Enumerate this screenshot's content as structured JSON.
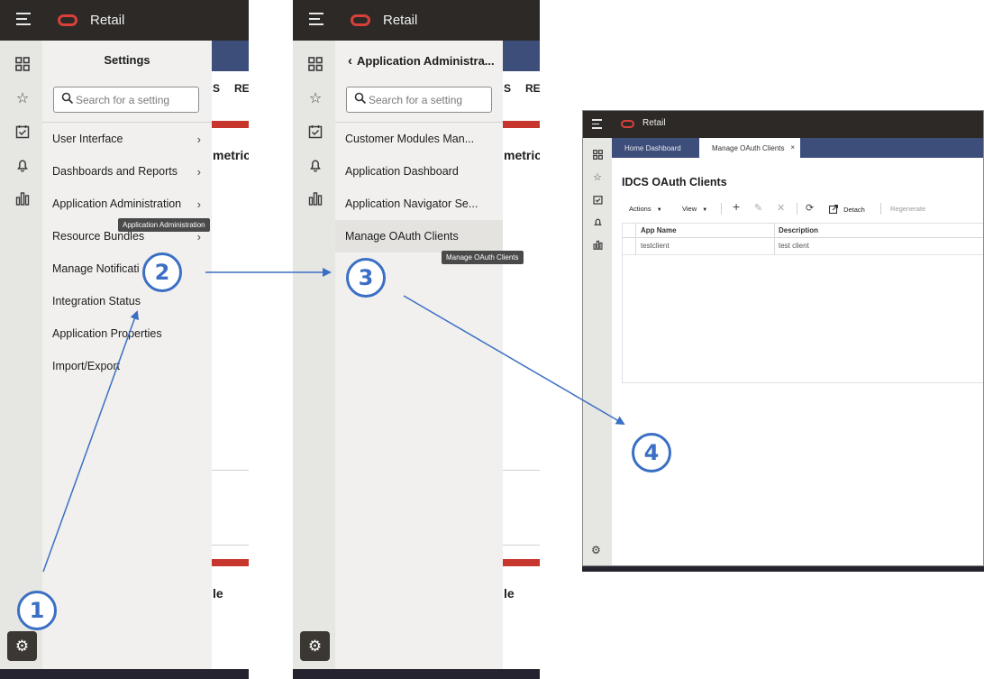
{
  "app": {
    "brand": "Retail"
  },
  "panel1": {
    "drawer_title": "Settings",
    "search_placeholder": "Search for a setting",
    "items": [
      {
        "label": "User Interface",
        "chevron": "›"
      },
      {
        "label": "Dashboards and Reports",
        "chevron": "›"
      },
      {
        "label": "Application Administration",
        "chevron": "›"
      },
      {
        "label": "Resource Bundles",
        "chevron": "›"
      },
      {
        "label": "Manage Notificati"
      },
      {
        "label": "Integration Status"
      },
      {
        "label": "Application Properties"
      },
      {
        "label": "Import/Export"
      }
    ],
    "tooltip": "Application Administration",
    "bg_text": {
      "tab": "S",
      "tab2": "RE",
      "heading": "metric",
      "heading2": "le"
    }
  },
  "panel2": {
    "back_title": "Application Administra...",
    "back_icon": "‹",
    "search_placeholder": "Search for a setting",
    "items": [
      {
        "label": "Customer Modules Man..."
      },
      {
        "label": "Application Dashboard"
      },
      {
        "label": "Application Navigator Se..."
      },
      {
        "label": "Manage OAuth Clients"
      }
    ],
    "tooltip": "Manage OAuth Clients",
    "bg_text": {
      "tab": "S",
      "tab2": "RE",
      "heading": "metric",
      "heading2": "le"
    }
  },
  "panel3": {
    "brand": "Retail",
    "tabs": {
      "home": "Home Dashboard",
      "oauth": "Manage OAuth Clients",
      "close": "×"
    },
    "title": "IDCS OAuth Clients",
    "toolbar": {
      "actions": "Actions",
      "view": "View",
      "caret": "▼",
      "detach": "Detach",
      "regenerate": "Regenerate"
    },
    "table": {
      "columns": [
        "App Name",
        "Description"
      ],
      "rows": [
        {
          "app_name": "testclient",
          "description": "test client"
        }
      ]
    }
  },
  "callouts": [
    "1",
    "2",
    "3",
    "4"
  ],
  "colors": {
    "accent": "#3b6fc4",
    "topbar": "#2d2926",
    "brand_red": "#d8413a",
    "tabstrip": "#3d4e7a"
  },
  "icons": {
    "rail": [
      "grid-icon",
      "star-icon",
      "tasks-icon",
      "bell-icon",
      "chart-icon"
    ],
    "settings": "gear-icon"
  }
}
